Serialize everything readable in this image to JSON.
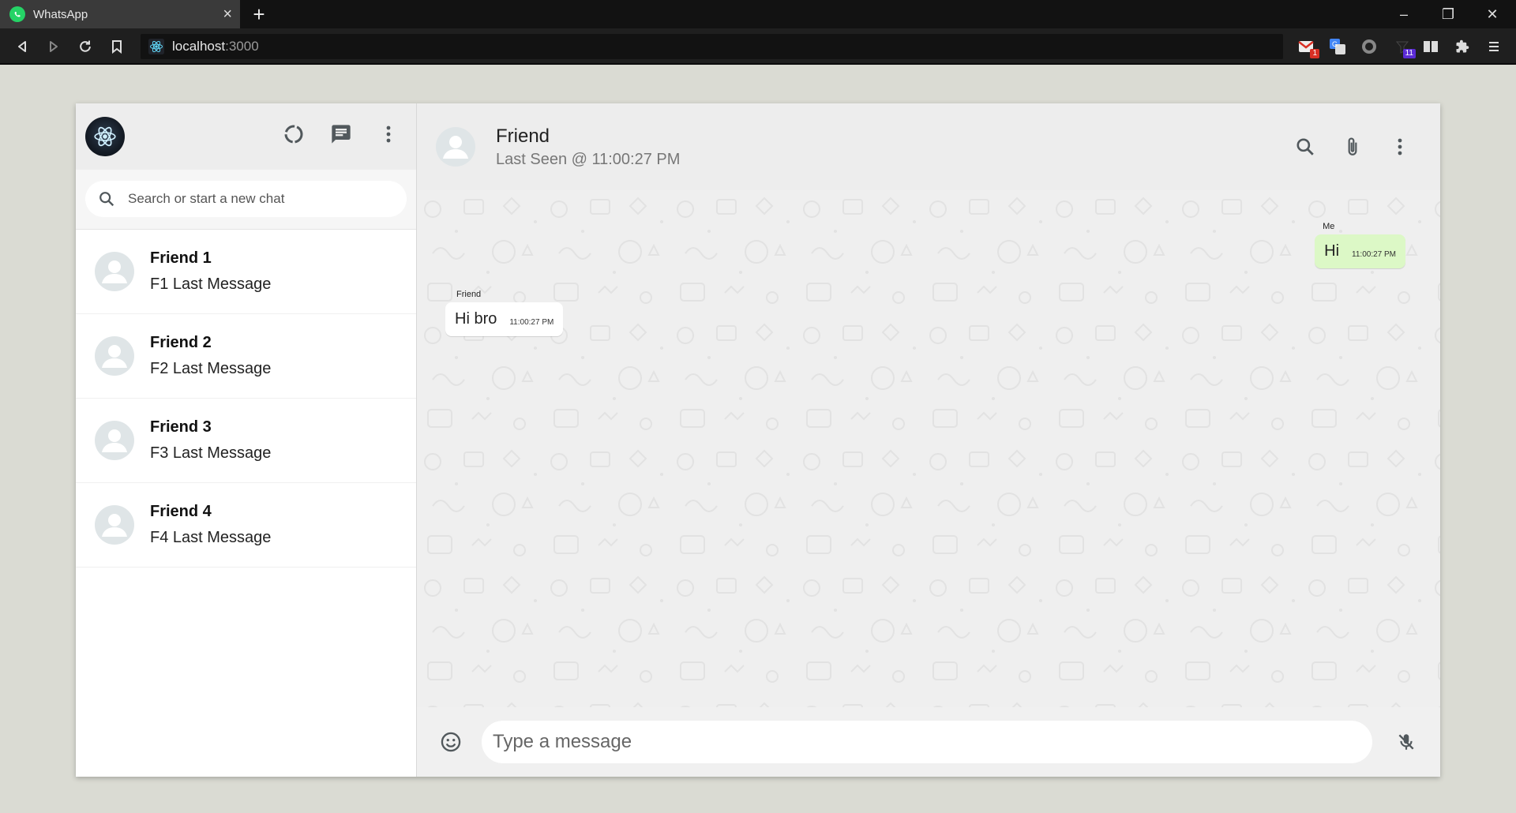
{
  "browser": {
    "tab_title": "WhatsApp",
    "tab_close": "×",
    "new_tab": "+",
    "url_host": "localhost",
    "url_port": ":3000",
    "window_controls": {
      "minimize": "–",
      "maximize": "❐",
      "close": "✕"
    },
    "extension_badges": {
      "gmail": "1",
      "counter": "11"
    }
  },
  "sidebar": {
    "search_placeholder": "Search or start a new chat",
    "chats": [
      {
        "name": "Friend 1",
        "last_message": "F1 Last Message"
      },
      {
        "name": "Friend 2",
        "last_message": "F2 Last Message"
      },
      {
        "name": "Friend 3",
        "last_message": "F3 Last Message"
      },
      {
        "name": "Friend 4",
        "last_message": "F4 Last Message"
      }
    ]
  },
  "chat": {
    "contact_name": "Friend",
    "last_seen": "Last Seen @ 11:00:27 PM",
    "messages": [
      {
        "sender": "Me",
        "text": "Hi",
        "time": "11:00:27 PM",
        "direction": "outgoing"
      },
      {
        "sender": "Friend",
        "text": "Hi bro",
        "time": "11:00:27 PM",
        "direction": "incoming"
      }
    ],
    "input_placeholder": "Type a message"
  },
  "colors": {
    "app_background": "#dadbd3",
    "outgoing_bubble": "#dcf8c6",
    "incoming_bubble": "#ffffff",
    "header_background": "#ededed",
    "brand_green": "#25d366"
  }
}
